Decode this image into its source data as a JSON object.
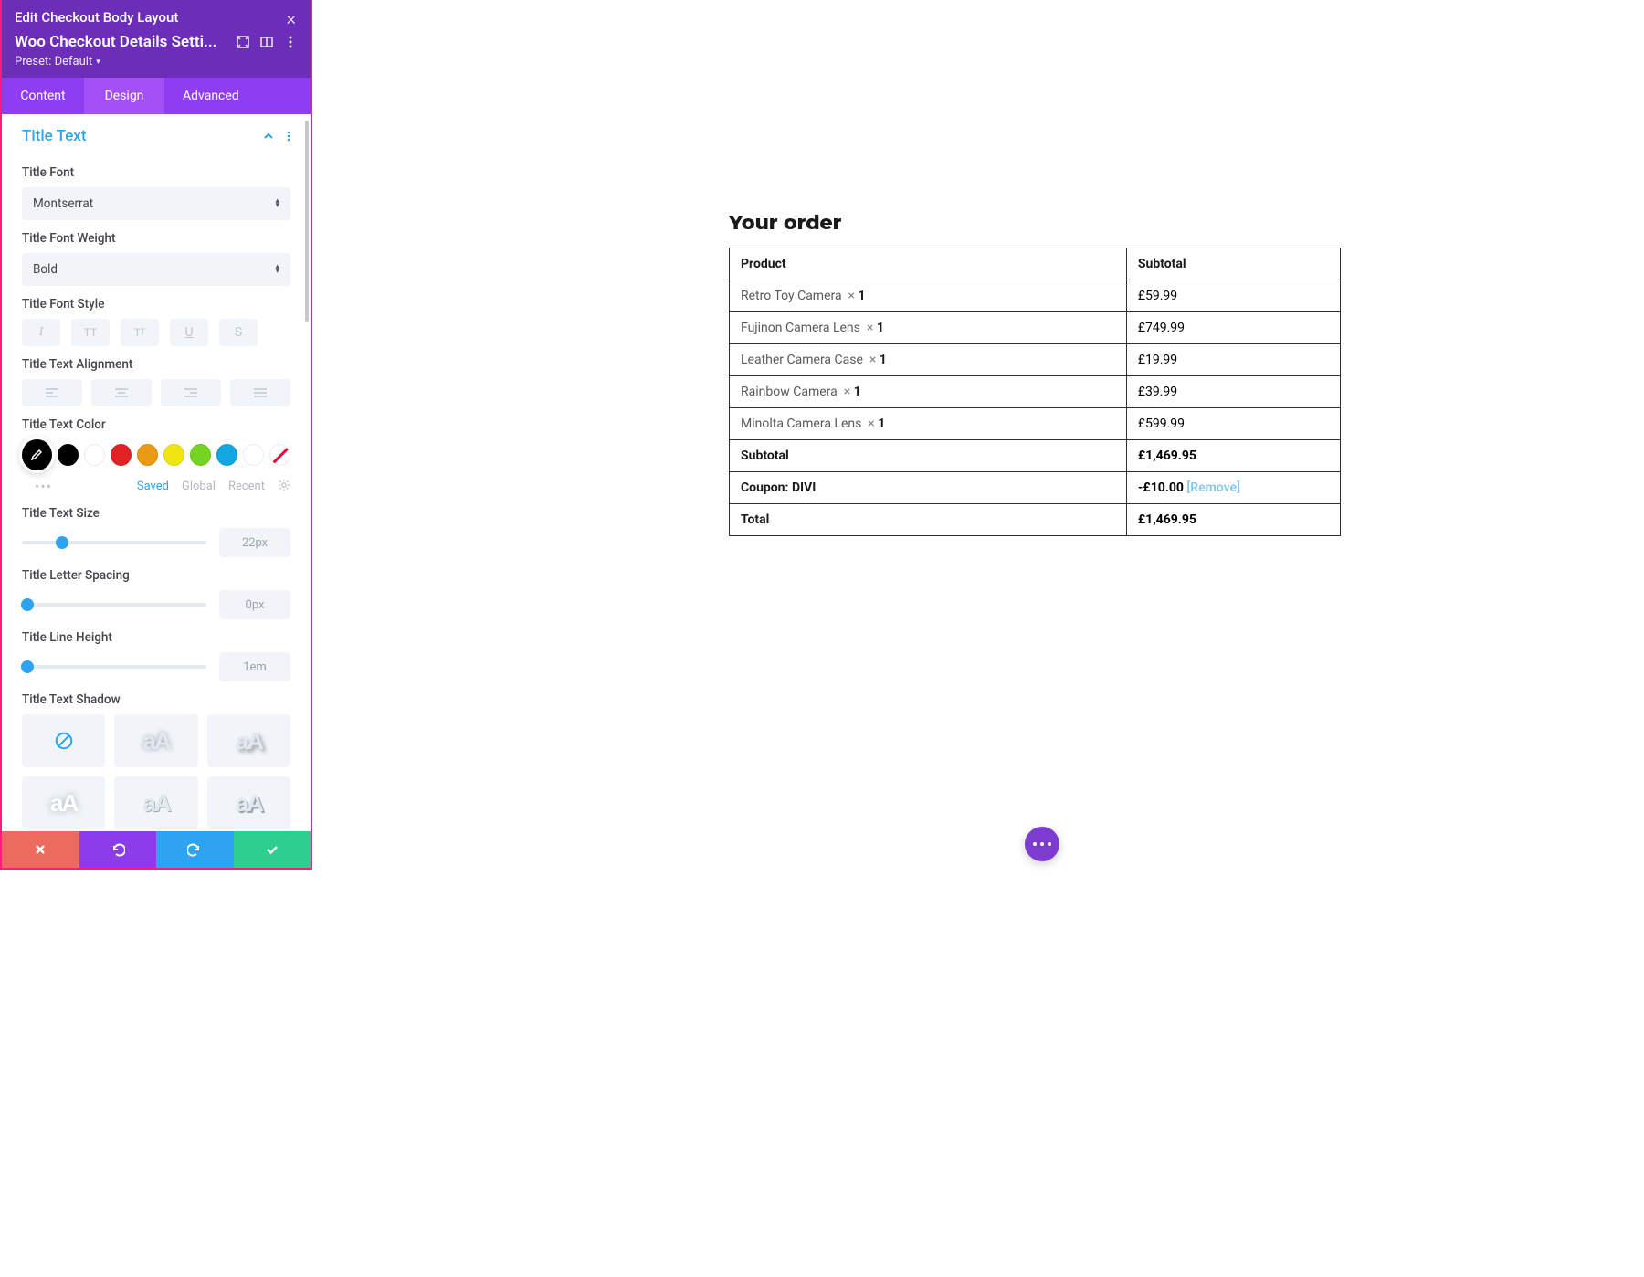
{
  "header": {
    "title": "Edit Checkout Body Layout",
    "module_name": "Woo Checkout Details Setti...",
    "preset_label": "Preset: Default"
  },
  "tabs": {
    "content": "Content",
    "design": "Design",
    "advanced": "Advanced"
  },
  "section": {
    "title": "Title Text",
    "font_label": "Title Font",
    "font_value": "Montserrat",
    "weight_label": "Title Font Weight",
    "weight_value": "Bold",
    "style_label": "Title Font Style",
    "align_label": "Title Text Alignment",
    "color_label": "Title Text Color",
    "palette": {
      "options": [
        "#000000",
        "#ffffff",
        "#e02323",
        "#eb9a13",
        "#f1e50f",
        "#75d41f",
        "#12a7e0",
        "#ffffff"
      ],
      "saved": "Saved",
      "global": "Global",
      "recent": "Recent"
    },
    "size_label": "Title Text Size",
    "size_value": "22px",
    "spacing_label": "Title Letter Spacing",
    "spacing_value": "0px",
    "lineheight_label": "Title Line Height",
    "lineheight_value": "1em",
    "shadow_label": "Title Text Shadow"
  },
  "order": {
    "title": "Your order",
    "col_product": "Product",
    "col_subtotal": "Subtotal",
    "items": [
      {
        "name": "Retro Toy Camera",
        "qty": "1",
        "price": "£59.99"
      },
      {
        "name": "Fujinon Camera Lens",
        "qty": "1",
        "price": "£749.99"
      },
      {
        "name": "Leather Camera Case",
        "qty": "1",
        "price": "£19.99"
      },
      {
        "name": "Rainbow Camera",
        "qty": "1",
        "price": "£39.99"
      },
      {
        "name": "Minolta Camera Lens",
        "qty": "1",
        "price": "£599.99"
      }
    ],
    "subtotal_label": "Subtotal",
    "subtotal_value": "£1,469.95",
    "coupon_label": "Coupon: DIVI",
    "coupon_value": "-£10.00",
    "remove_label": "[Remove]",
    "total_label": "Total",
    "total_value": "£1,469.95"
  }
}
